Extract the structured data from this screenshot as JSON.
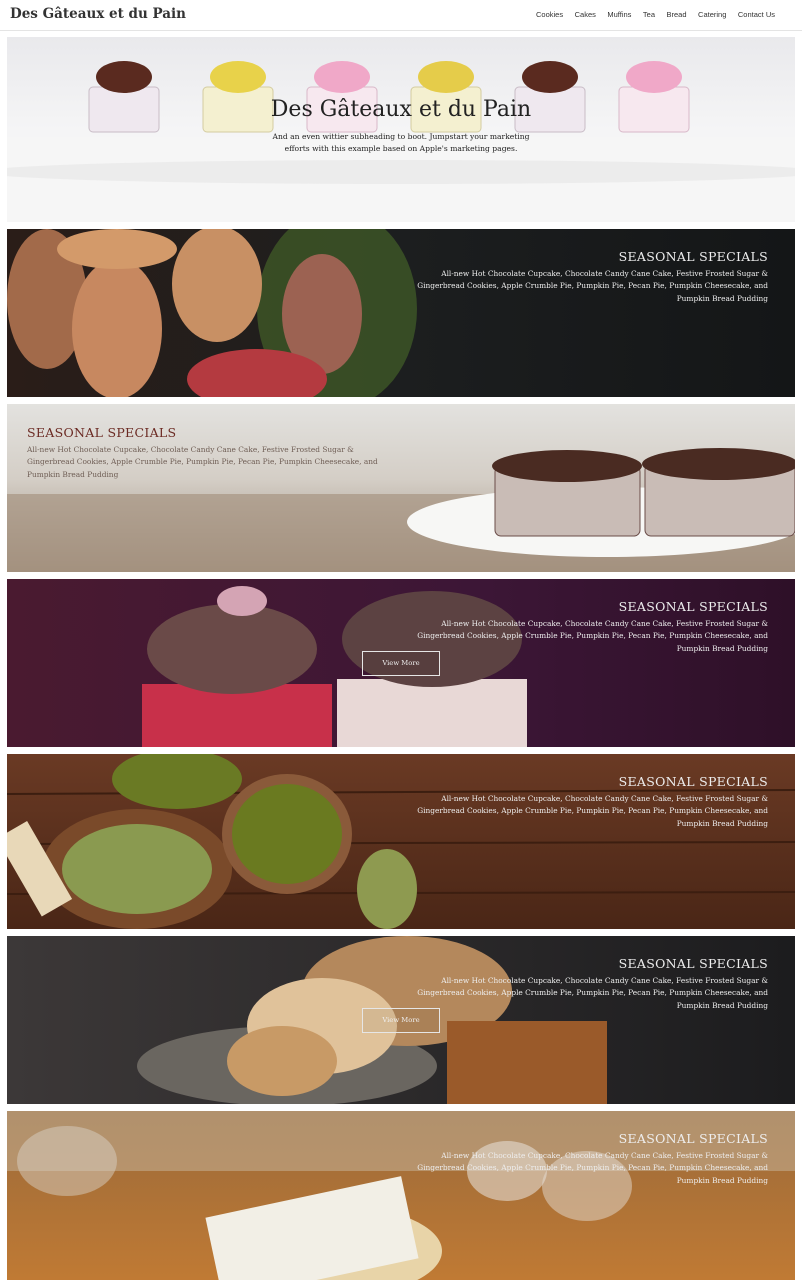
{
  "navbar": {
    "brand": "Des Gâteaux et du Pain",
    "links": [
      "Cookies",
      "Cakes",
      "Muffins",
      "Tea",
      "Bread",
      "Catering",
      "Contact Us"
    ]
  },
  "hero": {
    "title": "Des Gâteaux et du Pain",
    "subtitle": "And an even wittier subheading to boot. Jumpstart your marketing efforts with this example based on Apple's marketing pages."
  },
  "panels": [
    {
      "title": "SEASONAL SPECIALS",
      "desc": "All-new Hot Chocolate Cupcake, Chocolate Candy Cane Cake, Festive Frosted Sugar & Gingerbread Cookies, Apple Crumble Pie, Pumpkin Pie, Pecan Pie, Pumpkin Cheesecake, and Pumpkin Bread Pudding"
    },
    {
      "title": "SEASONAL SPECIALS",
      "desc": "All-new Hot Chocolate Cupcake, Chocolate Candy Cane Cake, Festive Frosted Sugar & Gingerbread Cookies, Apple Crumble Pie, Pumpkin Pie, Pecan Pie, Pumpkin Cheesecake, and Pumpkin Bread Pudding"
    },
    {
      "title": "SEASONAL SPECIALS",
      "desc": "All-new Hot Chocolate Cupcake, Chocolate Candy Cane Cake, Festive Frosted Sugar & Gingerbread Cookies, Apple Crumble Pie, Pumpkin Pie, Pecan Pie, Pumpkin Cheesecake, and Pumpkin Bread Pudding",
      "button": "View More"
    },
    {
      "title": "SEASONAL SPECIALS",
      "desc": "All-new Hot Chocolate Cupcake, Chocolate Candy Cane Cake, Festive Frosted Sugar & Gingerbread Cookies, Apple Crumble Pie, Pumpkin Pie, Pecan Pie, Pumpkin Cheesecake, and Pumpkin Bread Pudding"
    },
    {
      "title": "SEASONAL SPECIALS",
      "desc": "All-new Hot Chocolate Cupcake, Chocolate Candy Cane Cake, Festive Frosted Sugar & Gingerbread Cookies, Apple Crumble Pie, Pumpkin Pie, Pecan Pie, Pumpkin Cheesecake, and Pumpkin Bread Pudding",
      "button": "View More"
    },
    {
      "title": "SEASONAL SPECIALS",
      "desc": "All-new Hot Chocolate Cupcake, Chocolate Candy Cane Cake, Festive Frosted Sugar & Gingerbread Cookies, Apple Crumble Pie, Pumpkin Pie, Pecan Pie, Pumpkin Cheesecake, and Pumpkin Bread Pudding"
    }
  ]
}
